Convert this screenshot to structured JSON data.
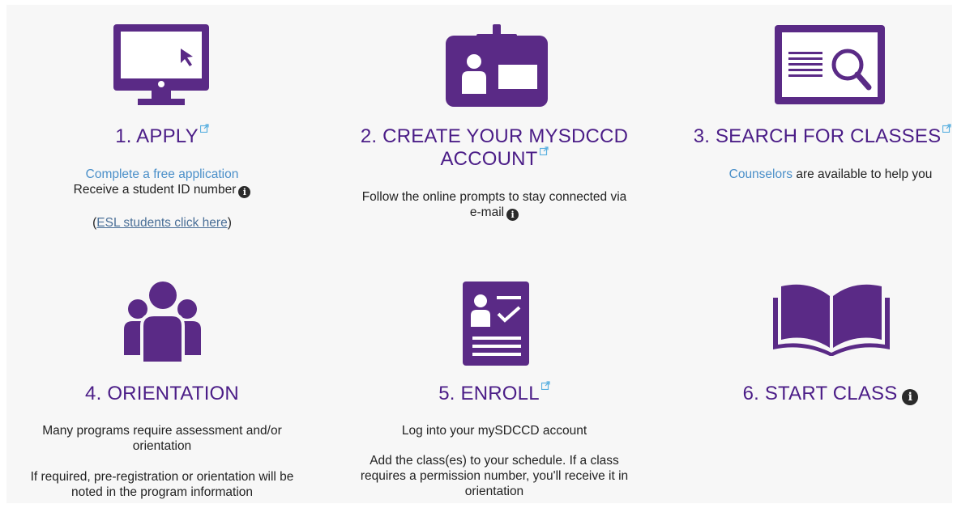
{
  "colors": {
    "accent": "#4b1d87",
    "link": "#4a8fc9",
    "icon": "#5a2a86"
  },
  "steps": [
    {
      "title": "1. APPLY",
      "icon": "computer-monitor-icon",
      "link1": "Complete a free application",
      "line2": "Receive a student ID number",
      "esl_open": "(",
      "esl_link": "ESL students click here",
      "esl_close": ")"
    },
    {
      "title_line1": "2. CREATE YOUR MYSDCCD",
      "title_line2": "ACCOUNT",
      "icon": "id-badge-icon",
      "desc_line1": "Follow the online prompts to stay connected via",
      "desc_line2": "e-mail"
    },
    {
      "title": "3. SEARCH FOR CLASSES",
      "icon": "search-document-icon",
      "link": "Counselors",
      "desc_rest": " are available to help you"
    },
    {
      "title": "4. ORIENTATION",
      "icon": "group-people-icon",
      "p1_line1": "Many programs require assessment and/or",
      "p1_line2": "orientation",
      "p2_line1": "If required, pre-registration or orientation will be",
      "p2_line2": "noted in the program information"
    },
    {
      "title": "5. ENROLL",
      "icon": "checklist-profile-icon",
      "p1": "Log into your mySDCCD account",
      "p2_line1": "Add the class(es) to your schedule. If a class",
      "p2_line2": "requires a permission number, you'll receive it in",
      "p2_line3": "orientation"
    },
    {
      "title": "6. START CLASS",
      "icon": "open-book-icon"
    }
  ],
  "info_glyph": "i"
}
